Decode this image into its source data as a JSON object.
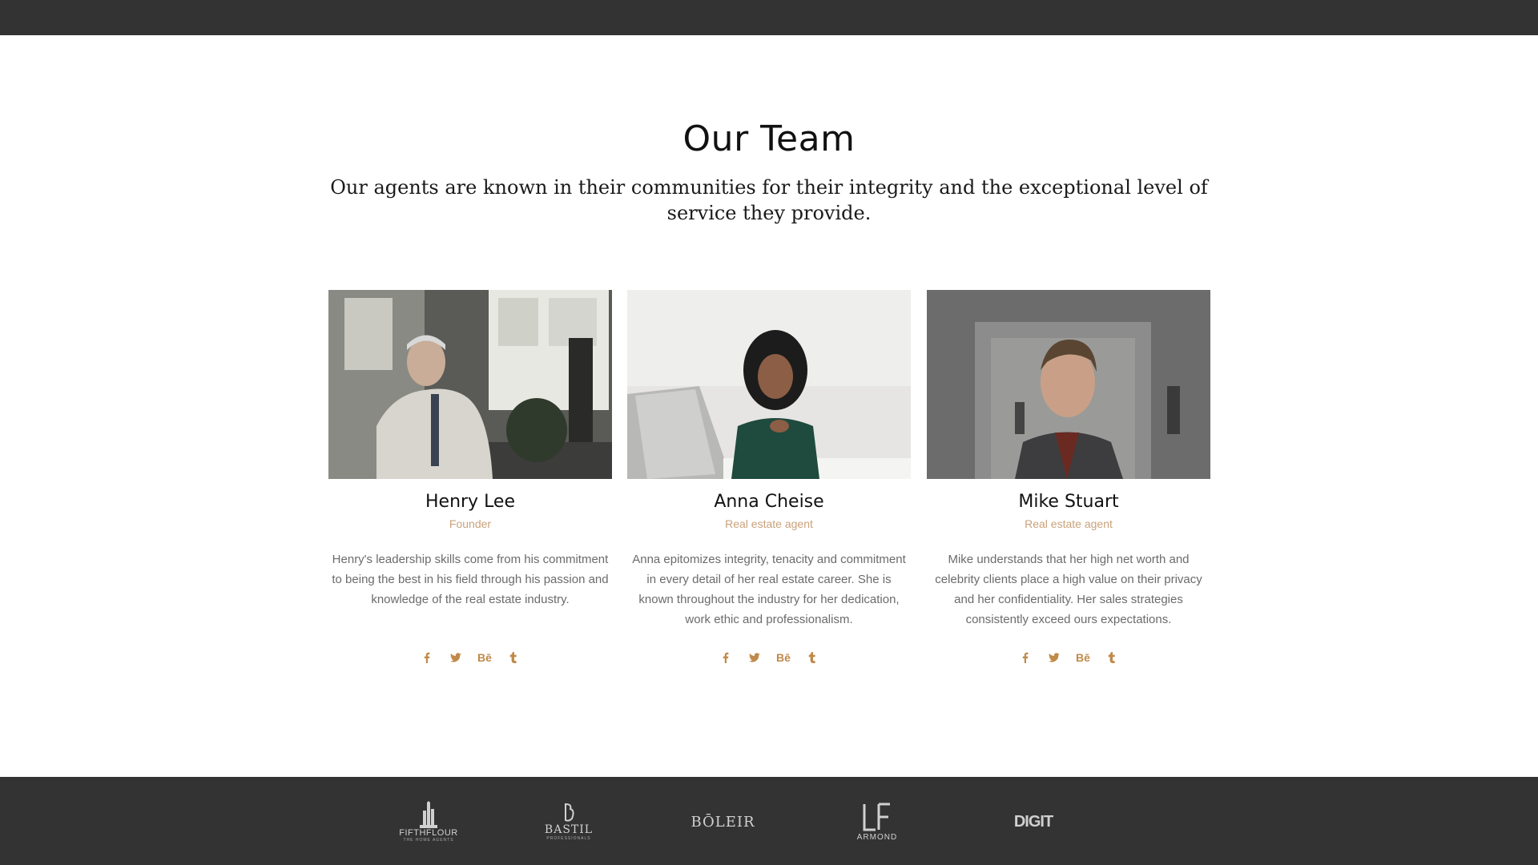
{
  "section": {
    "title": "Our Team",
    "subtitle": "Our agents are known in their communities for their integrity and the exceptional level of service they provide."
  },
  "team": [
    {
      "name": "Henry Lee",
      "role": "Founder",
      "bio": "Henry's leadership skills come from his commitment to being the best in his field through his passion and knowledge of the real estate industry.",
      "socials": [
        "facebook-icon",
        "twitter-icon",
        "behance-icon",
        "tumblr-icon"
      ]
    },
    {
      "name": "Anna Cheise",
      "role": "Real estate agent",
      "bio": "Anna epitomizes integrity, tenacity and commitment in every detail of her real estate career. She is known throughout the industry for her dedication, work ethic and professionalism.",
      "socials": [
        "facebook-icon",
        "twitter-icon",
        "behance-icon",
        "tumblr-icon"
      ]
    },
    {
      "name": "Mike Stuart",
      "role": "Real estate agent",
      "bio": "Mike understands that her high net worth and celebrity clients place a high value on their privacy and her confidentiality. Her sales strategies consistently exceed ours expectations.",
      "socials": [
        "facebook-icon",
        "twitter-icon",
        "behance-icon",
        "tumblr-icon"
      ]
    }
  ],
  "partners": [
    {
      "name": "FIFTHFLOUR",
      "tagline": "THE HOME AGENTS"
    },
    {
      "name": "BASTIL",
      "tagline": "PROFESSIONALS"
    },
    {
      "name": "BŌLEIR",
      "tagline": ""
    },
    {
      "name": "ARMOND",
      "tagline": ""
    },
    {
      "name": "DIGIT",
      "tagline": ""
    }
  ],
  "colors": {
    "accent": "#c08a4a",
    "role": "#c9a27a",
    "bar": "#333333"
  }
}
